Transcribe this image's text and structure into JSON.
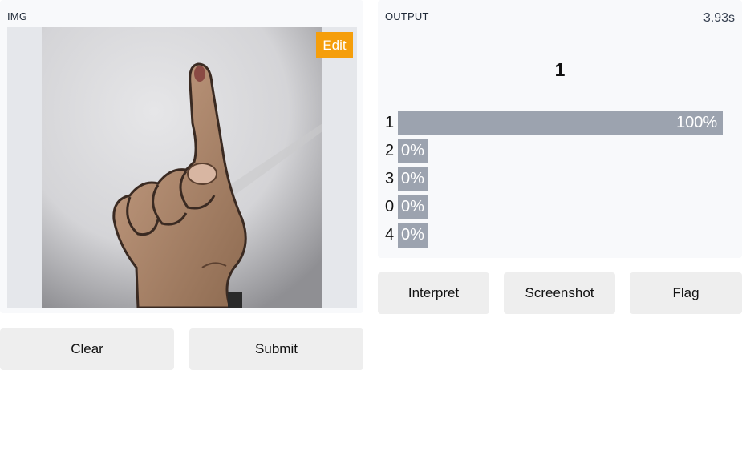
{
  "input": {
    "label": "IMG",
    "edit_label": "Edit",
    "image_description_icon": "hand-one-finger-photo"
  },
  "buttons": {
    "clear": "Clear",
    "submit": "Submit",
    "interpret": "Interpret",
    "screenshot": "Screenshot",
    "flag": "Flag"
  },
  "output": {
    "label": "OUTPUT",
    "time": "3.93s",
    "top_label": "1",
    "confidences": [
      {
        "label": "1",
        "percent_text": "100%",
        "value": 1.0
      },
      {
        "label": "2",
        "percent_text": "0%",
        "value": 0.0
      },
      {
        "label": "3",
        "percent_text": "0%",
        "value": 0.0
      },
      {
        "label": "0",
        "percent_text": "0%",
        "value": 0.0
      },
      {
        "label": "4",
        "percent_text": "0%",
        "value": 0.0
      }
    ]
  },
  "colors": {
    "accent_edit": "#f59e0b",
    "bar": "#9ca3af",
    "panel_bg": "#f8f9fb",
    "button_bg": "#eeeeee"
  }
}
